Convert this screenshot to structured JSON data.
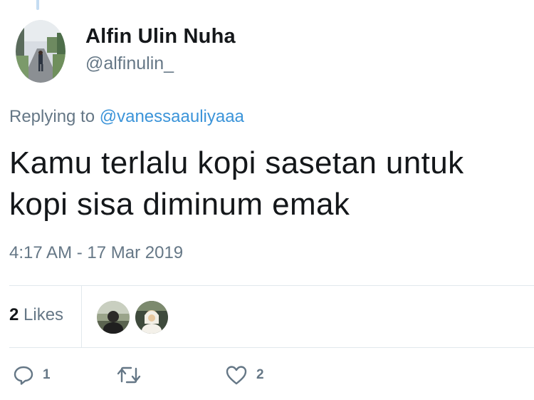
{
  "tweet": {
    "author": {
      "display_name": "Alfin Ulin Nuha",
      "handle": "@alfinulin_"
    },
    "replying": {
      "prefix": "Replying to",
      "mention": "@vanessaauliyaaa"
    },
    "text_line1": "Kamu terlalu kopi sasetan untuk",
    "text_line2": "kopi sisa diminum emak",
    "timestamp": "4:17 AM - 17 Mar 2019",
    "likes": {
      "count": "2",
      "label": "Likes"
    },
    "actions": {
      "reply_count": "1",
      "retweet_count": "",
      "like_count": "2"
    }
  },
  "colors": {
    "text": "#14171a",
    "secondary": "#657786",
    "link": "#3b94d9",
    "divider": "#e1e8ed",
    "thread_line": "#c4dcf2"
  },
  "icons": {
    "reply": "reply-icon",
    "retweet": "retweet-icon",
    "like": "heart-icon"
  }
}
